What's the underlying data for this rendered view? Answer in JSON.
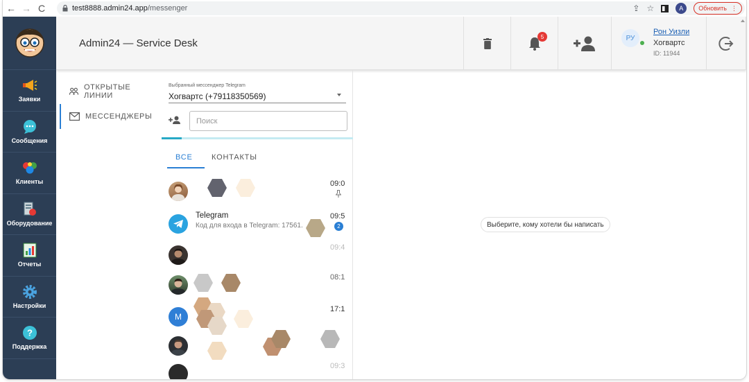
{
  "browser": {
    "url_host": "test8888.admin24.app",
    "url_path": "/messenger",
    "profile_initial": "A",
    "update_label": "Обновить"
  },
  "sidebar": {
    "items": [
      {
        "label": "Заявки",
        "icon": "megaphone-icon"
      },
      {
        "label": "Сообщения",
        "icon": "chat-bubble-icon"
      },
      {
        "label": "Клиенты",
        "icon": "clients-icon"
      },
      {
        "label": "Оборудование",
        "icon": "equipment-icon"
      },
      {
        "label": "Отчеты",
        "icon": "reports-icon"
      },
      {
        "label": "Настройки",
        "icon": "gear-icon"
      },
      {
        "label": "Поддержка",
        "icon": "help-icon"
      }
    ]
  },
  "header": {
    "title": "Admin24 — Service Desk",
    "notifications_count": "5",
    "user": {
      "initials": "РУ",
      "name": "Рон Уизли",
      "org": "Хогвартс",
      "id": "ID: 11944"
    }
  },
  "subnav": {
    "items": [
      {
        "label": "ОТКРЫТЫЕ ЛИНИИ",
        "icon": "open-lines-icon"
      },
      {
        "label": "МЕССЕНДЖЕРЫ",
        "icon": "messengers-icon"
      }
    ]
  },
  "panel": {
    "messenger_label": "Выбранный мессенджер Telegram",
    "messenger_value": "Хогвартс (+79118350569)",
    "search_placeholder": "Поиск",
    "tabs": [
      "ВСЕ",
      "КОНТАКТЫ"
    ],
    "chats": [
      {
        "name": "",
        "snippet": "",
        "time": "09:0",
        "pinned": true,
        "unread": "",
        "avatar": "photo",
        "faded": false
      },
      {
        "name": "Telegram",
        "snippet": "Код для входа в Telegram: 17561.",
        "time": "09:5",
        "pinned": false,
        "unread": "2",
        "avatar": "telegram",
        "faded": false
      },
      {
        "name": "",
        "snippet": "",
        "time": "09:4",
        "pinned": false,
        "unread": "",
        "avatar": "photo",
        "faded": true
      },
      {
        "name": "",
        "snippet": "",
        "time": "08:1",
        "pinned": false,
        "unread": "",
        "avatar": "photo",
        "faded": true
      },
      {
        "name": "",
        "snippet": "",
        "time": "17:1",
        "pinned": false,
        "unread": "",
        "avatar": "letter",
        "letter": "М",
        "faded": false
      },
      {
        "name": "",
        "snippet": "",
        "time": "",
        "pinned": false,
        "unread": "",
        "avatar": "photo",
        "faded": false
      },
      {
        "name": "",
        "snippet": "",
        "time": "09:3",
        "pinned": false,
        "unread": "",
        "avatar": "photo",
        "faded": true
      }
    ]
  },
  "main": {
    "empty_hint": "Выберите, кому хотели бы написать"
  },
  "colors": {
    "sidebar": "#2c3e55",
    "accent": "#2a7fd4",
    "badge": "#e53935",
    "telegram": "#2aa3e0"
  }
}
